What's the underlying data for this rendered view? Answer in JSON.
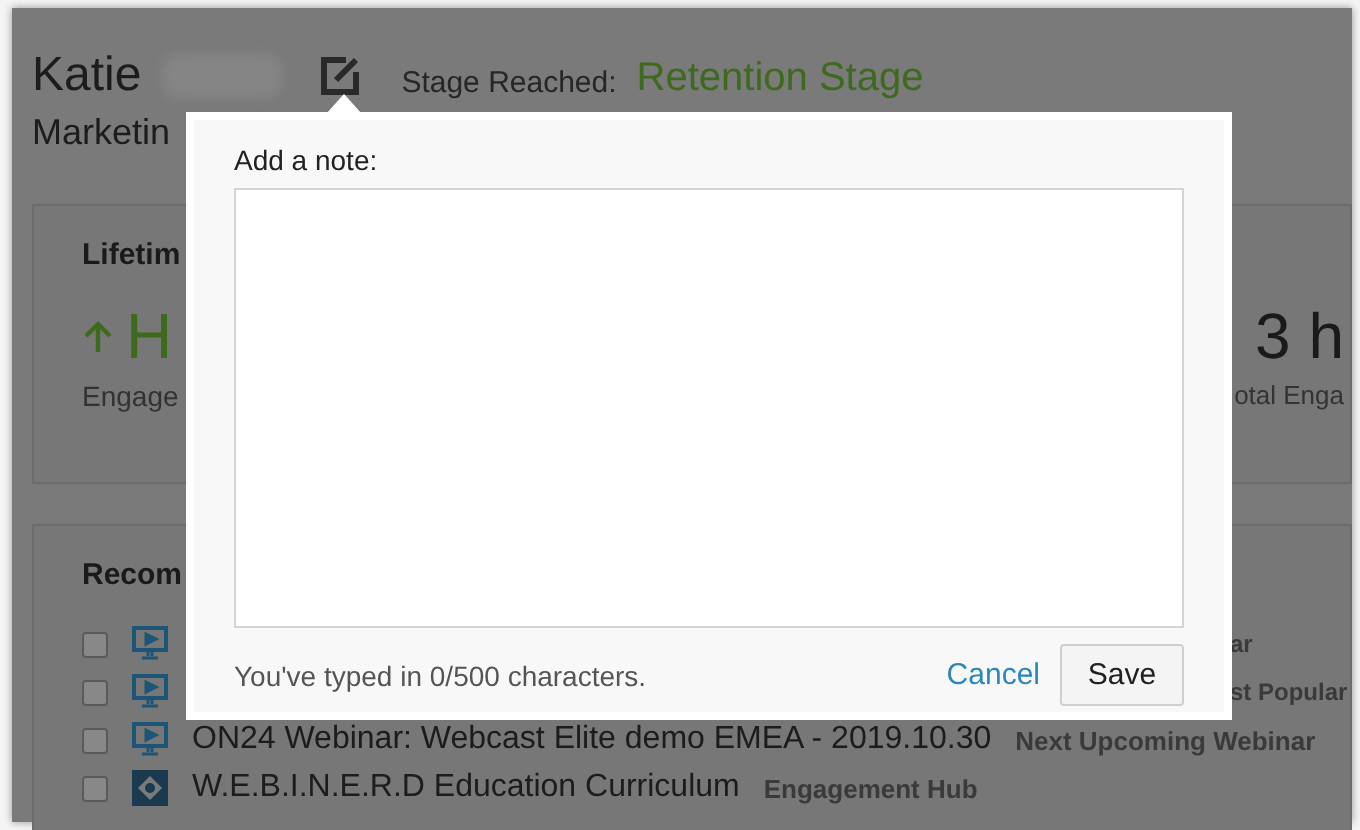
{
  "profile": {
    "first_name": "Katie",
    "title": "Marketin",
    "stage_label": "Stage Reached:",
    "stage_value": "Retention Stage"
  },
  "lifetime_card": {
    "heading": "Lifetim",
    "left_value": "H",
    "left_caption": "Engage",
    "right_value": "3 h",
    "right_caption": "otal Enga"
  },
  "recommendations": {
    "heading": "Recom",
    "items": [
      {
        "kind": "webinar",
        "tag": "ar",
        "checked": false
      },
      {
        "kind": "webinar",
        "tag": "st Popular",
        "checked": false
      },
      {
        "kind": "webinar",
        "title": "ON24 Webinar: Webcast Elite demo EMEA - 2019.10.30",
        "tag": "Next Upcoming Webinar",
        "checked": false
      },
      {
        "kind": "hub",
        "title": "W.E.B.I.N.E.R.D Education Curriculum",
        "tag": "Engagement Hub",
        "checked": false
      }
    ]
  },
  "note_dialog": {
    "label": "Add a note:",
    "counter": "You've typed in 0/500 characters.",
    "cancel": "Cancel",
    "save": "Save"
  }
}
